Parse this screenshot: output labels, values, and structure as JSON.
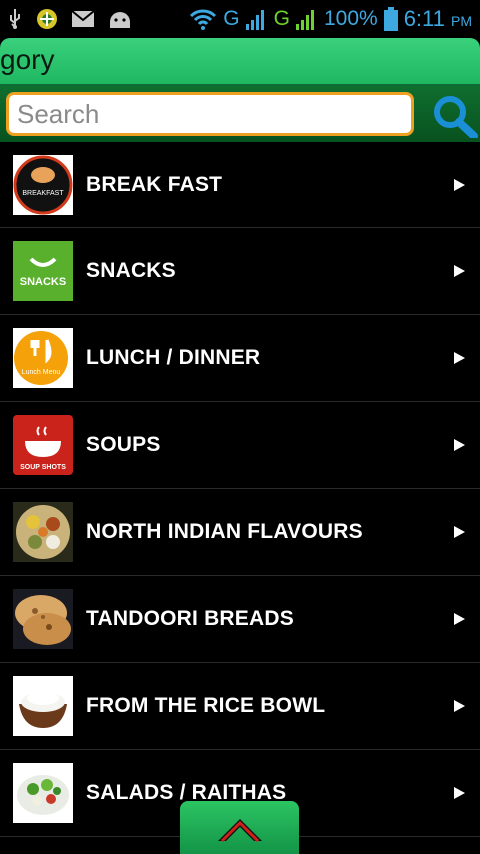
{
  "status_bar": {
    "icons": [
      "usb-icon",
      "app-icon",
      "mail-icon",
      "android-icon",
      "wifi-icon",
      "signal-icon"
    ],
    "network_1": "G",
    "network_2": "G",
    "battery": "100%",
    "time": "6:11",
    "ampm": "PM"
  },
  "header": {
    "title": "gory"
  },
  "search": {
    "placeholder": "Search",
    "value": ""
  },
  "categories": [
    {
      "label": "BREAK FAST",
      "thumb_text": "BREAKFAST"
    },
    {
      "label": "SNACKS",
      "thumb_text": "SNACKS"
    },
    {
      "label": "LUNCH / DINNER",
      "thumb_text": "Lunch Menu"
    },
    {
      "label": "SOUPS",
      "thumb_text": "SOUP SHOTS"
    },
    {
      "label": "NORTH INDIAN FLAVOURS",
      "thumb_text": ""
    },
    {
      "label": "TANDOORI BREADS",
      "thumb_text": ""
    },
    {
      "label": "FROM THE RICE BOWL",
      "thumb_text": ""
    },
    {
      "label": "SALADS / RAITHAS",
      "thumb_text": ""
    }
  ],
  "colors": {
    "accent_green": "#1fb861",
    "search_border": "#f0a020",
    "search_icon": "#1a8fd6",
    "status_blue": "#3ea8e0"
  }
}
